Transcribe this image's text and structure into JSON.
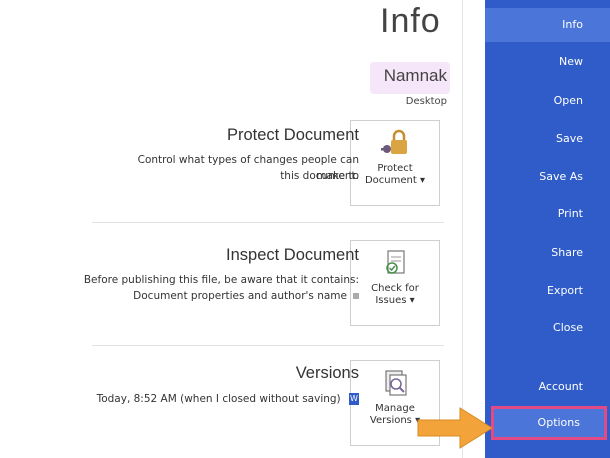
{
  "page": {
    "title": "Info"
  },
  "file": {
    "name": "Namnak",
    "location": "Desktop"
  },
  "protect": {
    "title": "Protect Document",
    "desc_line1": "Control what types of changes people can make to",
    "desc_line2": "this document.",
    "tile_line1": "Protect",
    "tile_line2": "Document ▾"
  },
  "inspect": {
    "title": "Inspect Document",
    "desc": "Before publishing this file, be aware that it contains:",
    "bullet": "Document properties and author's name",
    "tile_line1": "Check for",
    "tile_line2": "Issues ▾"
  },
  "versions": {
    "title": "Versions",
    "entry": "Today, 8:52 AM (when I closed without saving)",
    "tile_line1": "Manage",
    "tile_line2": "Versions ▾"
  },
  "sidebar": {
    "items": [
      {
        "label": "Info"
      },
      {
        "label": "New"
      },
      {
        "label": "Open"
      },
      {
        "label": "Save"
      },
      {
        "label": "Save As"
      },
      {
        "label": "Print"
      },
      {
        "label": "Share"
      },
      {
        "label": "Export"
      },
      {
        "label": "Close"
      },
      {
        "label": "Account"
      },
      {
        "label": "Options"
      }
    ]
  },
  "colors": {
    "sidebar": "#2f5cc8",
    "highlight": "#e24a86",
    "arrow": "#f2a43a"
  }
}
